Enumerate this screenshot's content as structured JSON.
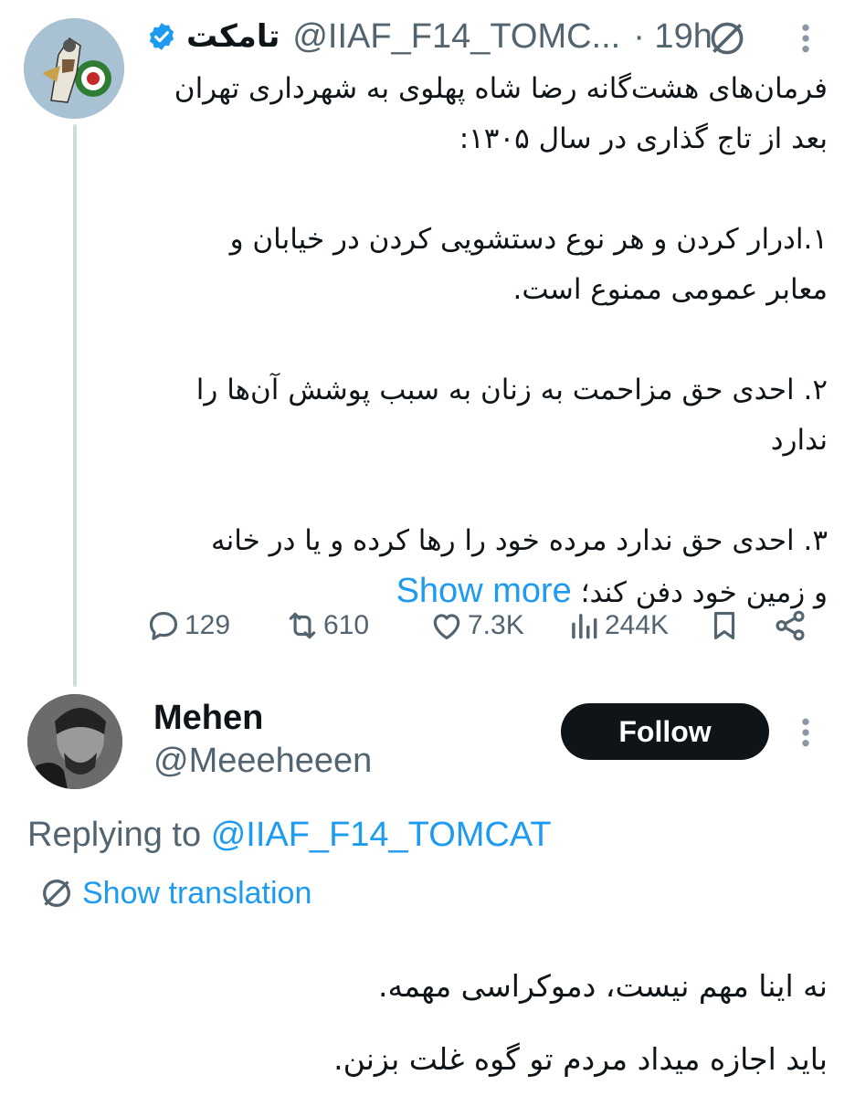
{
  "tweet": {
    "display_name": "تامکت",
    "handle": "@IIAF_F14_TOMC...",
    "time": "· 19h",
    "lines": [
      "فرمان‌های هشت‌گانه رضا شاه پهلوی به شهرداری تهران",
      "بعد از تاج گذاری در سال ۱۳۰۵:",
      "۱.ادرار کردن و هر نوع دستشویی کردن در خیابان و",
      "معابر عمومی ممنوع است.",
      "۲. احدی حق مزاحمت به زنان به سبب پوشش آن‌ها را",
      "ندارد",
      "۳. احدی حق ندارد مرده خود را رها کرده و یا در خانه",
      "و زمین خود دفن کند؛"
    ],
    "show_more": "Show more",
    "stats": {
      "replies": "129",
      "retweets": "610",
      "likes": "7.3K",
      "views": "244K"
    }
  },
  "reply": {
    "display_name": "Mehen",
    "handle": "@Meeeheeen",
    "follow_label": "Follow",
    "replying_prefix": "Replying to",
    "replying_handle": "@IIAF_F14_TOMCAT",
    "show_translation": "Show translation",
    "lines": [
      "نه اینا مهم نیست،  دموکراسی مهمه.",
      "باید اجازه میداد مردم تو گوه غلت بزنن."
    ]
  },
  "colors": {
    "accent": "#1d9bf0",
    "secondary_text": "#536471",
    "primary_text": "#0f1419",
    "thread_line": "#cfd9de"
  },
  "icons": [
    "verified-badge-icon",
    "translate-icon",
    "more-icon",
    "reply-icon",
    "retweet-icon",
    "like-icon",
    "views-icon",
    "bookmark-icon",
    "share-icon"
  ]
}
